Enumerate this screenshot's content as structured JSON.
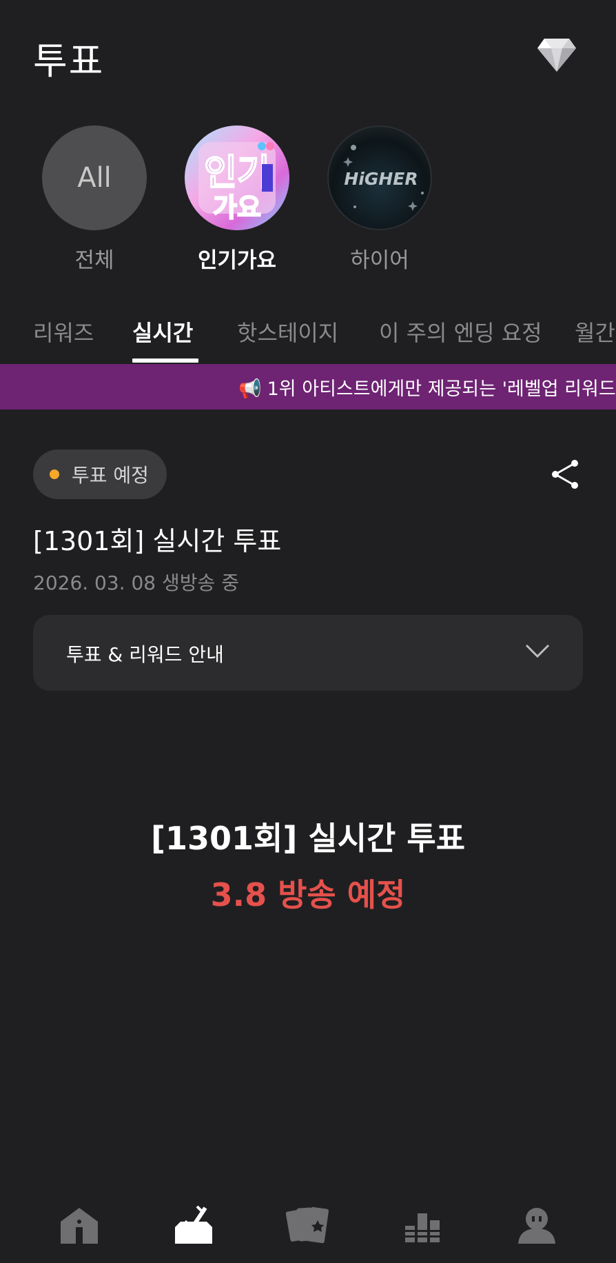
{
  "header": {
    "title": "투표",
    "diamond_icon": "diamond-icon"
  },
  "channels": [
    {
      "circle_text": "All",
      "label": "전체",
      "active": false
    },
    {
      "circle_text": "",
      "label": "인기가요",
      "active": true,
      "logo": "inkigayo-logo"
    },
    {
      "circle_text": "HiGHER",
      "label": "하이어",
      "active": false,
      "logo": "higher-logo"
    }
  ],
  "tabs": [
    {
      "label": "리워즈",
      "active": false
    },
    {
      "label": "실시간",
      "active": true
    },
    {
      "label": "핫스테이지",
      "active": false
    },
    {
      "label": "이 주의 엔딩 요정",
      "active": false
    },
    {
      "label": "월간",
      "active": false
    }
  ],
  "banner": {
    "icon": "📢",
    "text": "1위 아티스트에게만 제공되는 '레벨업 리워드'",
    "color": "#6e2373"
  },
  "vote": {
    "status": "투표 예정",
    "status_color": "#f6a928",
    "title": "[1301회] 실시간 투표",
    "date": "2026. 03. 08 생방송 중",
    "guide_label": "투표 & 리워드 안내"
  },
  "notice": {
    "title": "[1301회] 실시간 투표",
    "subtitle": "3.8 방송 예정",
    "subtitle_color": "#e5514c"
  },
  "nav": [
    {
      "name": "home-icon"
    },
    {
      "name": "vote-icon",
      "active": true
    },
    {
      "name": "cards-icon"
    },
    {
      "name": "ranking-icon"
    },
    {
      "name": "profile-icon"
    }
  ]
}
